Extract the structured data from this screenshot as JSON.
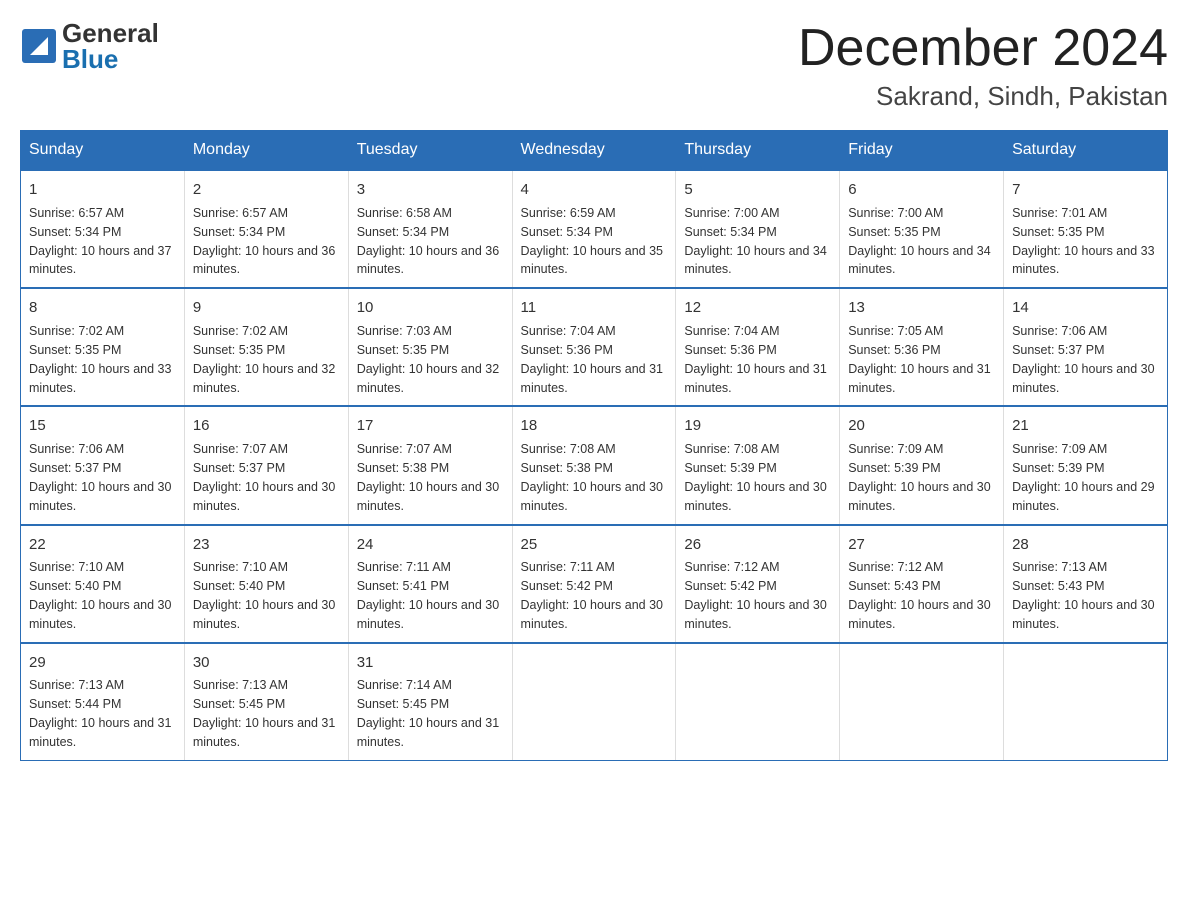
{
  "header": {
    "month_title": "December 2024",
    "location": "Sakrand, Sindh, Pakistan",
    "logo_general": "General",
    "logo_blue": "Blue"
  },
  "days_of_week": [
    "Sunday",
    "Monday",
    "Tuesday",
    "Wednesday",
    "Thursday",
    "Friday",
    "Saturday"
  ],
  "weeks": [
    [
      {
        "num": "1",
        "sunrise": "6:57 AM",
        "sunset": "5:34 PM",
        "daylight": "10 hours and 37 minutes."
      },
      {
        "num": "2",
        "sunrise": "6:57 AM",
        "sunset": "5:34 PM",
        "daylight": "10 hours and 36 minutes."
      },
      {
        "num": "3",
        "sunrise": "6:58 AM",
        "sunset": "5:34 PM",
        "daylight": "10 hours and 36 minutes."
      },
      {
        "num": "4",
        "sunrise": "6:59 AM",
        "sunset": "5:34 PM",
        "daylight": "10 hours and 35 minutes."
      },
      {
        "num": "5",
        "sunrise": "7:00 AM",
        "sunset": "5:34 PM",
        "daylight": "10 hours and 34 minutes."
      },
      {
        "num": "6",
        "sunrise": "7:00 AM",
        "sunset": "5:35 PM",
        "daylight": "10 hours and 34 minutes."
      },
      {
        "num": "7",
        "sunrise": "7:01 AM",
        "sunset": "5:35 PM",
        "daylight": "10 hours and 33 minutes."
      }
    ],
    [
      {
        "num": "8",
        "sunrise": "7:02 AM",
        "sunset": "5:35 PM",
        "daylight": "10 hours and 33 minutes."
      },
      {
        "num": "9",
        "sunrise": "7:02 AM",
        "sunset": "5:35 PM",
        "daylight": "10 hours and 32 minutes."
      },
      {
        "num": "10",
        "sunrise": "7:03 AM",
        "sunset": "5:35 PM",
        "daylight": "10 hours and 32 minutes."
      },
      {
        "num": "11",
        "sunrise": "7:04 AM",
        "sunset": "5:36 PM",
        "daylight": "10 hours and 31 minutes."
      },
      {
        "num": "12",
        "sunrise": "7:04 AM",
        "sunset": "5:36 PM",
        "daylight": "10 hours and 31 minutes."
      },
      {
        "num": "13",
        "sunrise": "7:05 AM",
        "sunset": "5:36 PM",
        "daylight": "10 hours and 31 minutes."
      },
      {
        "num": "14",
        "sunrise": "7:06 AM",
        "sunset": "5:37 PM",
        "daylight": "10 hours and 30 minutes."
      }
    ],
    [
      {
        "num": "15",
        "sunrise": "7:06 AM",
        "sunset": "5:37 PM",
        "daylight": "10 hours and 30 minutes."
      },
      {
        "num": "16",
        "sunrise": "7:07 AM",
        "sunset": "5:37 PM",
        "daylight": "10 hours and 30 minutes."
      },
      {
        "num": "17",
        "sunrise": "7:07 AM",
        "sunset": "5:38 PM",
        "daylight": "10 hours and 30 minutes."
      },
      {
        "num": "18",
        "sunrise": "7:08 AM",
        "sunset": "5:38 PM",
        "daylight": "10 hours and 30 minutes."
      },
      {
        "num": "19",
        "sunrise": "7:08 AM",
        "sunset": "5:39 PM",
        "daylight": "10 hours and 30 minutes."
      },
      {
        "num": "20",
        "sunrise": "7:09 AM",
        "sunset": "5:39 PM",
        "daylight": "10 hours and 30 minutes."
      },
      {
        "num": "21",
        "sunrise": "7:09 AM",
        "sunset": "5:39 PM",
        "daylight": "10 hours and 29 minutes."
      }
    ],
    [
      {
        "num": "22",
        "sunrise": "7:10 AM",
        "sunset": "5:40 PM",
        "daylight": "10 hours and 30 minutes."
      },
      {
        "num": "23",
        "sunrise": "7:10 AM",
        "sunset": "5:40 PM",
        "daylight": "10 hours and 30 minutes."
      },
      {
        "num": "24",
        "sunrise": "7:11 AM",
        "sunset": "5:41 PM",
        "daylight": "10 hours and 30 minutes."
      },
      {
        "num": "25",
        "sunrise": "7:11 AM",
        "sunset": "5:42 PM",
        "daylight": "10 hours and 30 minutes."
      },
      {
        "num": "26",
        "sunrise": "7:12 AM",
        "sunset": "5:42 PM",
        "daylight": "10 hours and 30 minutes."
      },
      {
        "num": "27",
        "sunrise": "7:12 AM",
        "sunset": "5:43 PM",
        "daylight": "10 hours and 30 minutes."
      },
      {
        "num": "28",
        "sunrise": "7:13 AM",
        "sunset": "5:43 PM",
        "daylight": "10 hours and 30 minutes."
      }
    ],
    [
      {
        "num": "29",
        "sunrise": "7:13 AM",
        "sunset": "5:44 PM",
        "daylight": "10 hours and 31 minutes."
      },
      {
        "num": "30",
        "sunrise": "7:13 AM",
        "sunset": "5:45 PM",
        "daylight": "10 hours and 31 minutes."
      },
      {
        "num": "31",
        "sunrise": "7:14 AM",
        "sunset": "5:45 PM",
        "daylight": "10 hours and 31 minutes."
      },
      null,
      null,
      null,
      null
    ]
  ]
}
